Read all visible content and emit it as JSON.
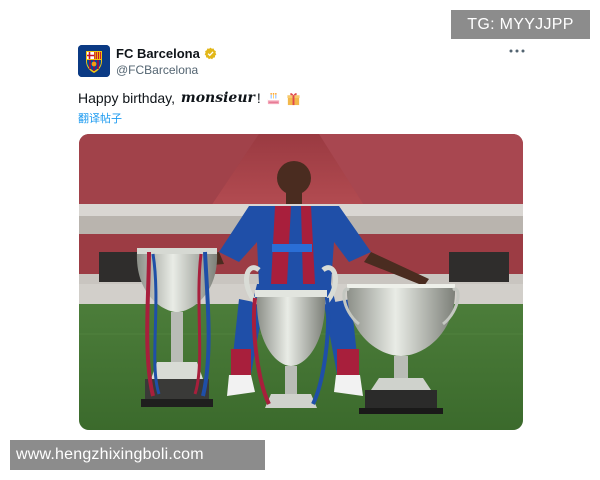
{
  "watermarks": {
    "top": "TG: MYYJJPP",
    "bottom": "www.hengzhixingboli.com"
  },
  "tweet": {
    "display_name": "FC Barcelona",
    "handle": "@FCBarcelona",
    "more_icon": "more-horizontal-icon",
    "verified_icon": "verified-badge-icon",
    "text_before": "Happy birthday, ",
    "text_emphasis": "monsieur",
    "text_after": "!",
    "emojis": [
      "birthday-cake-icon",
      "wrapped-gift-icon"
    ],
    "translate_label": "翻译帖子"
  },
  "colors": {
    "brand_blue": "#004d98",
    "brand_red": "#a50044",
    "link_blue": "#1d9bf0",
    "verified_gold": "#e2b719",
    "handle_gray": "#536471"
  }
}
